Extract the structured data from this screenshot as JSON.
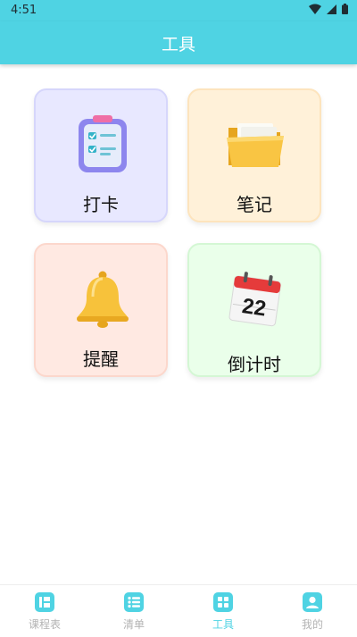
{
  "status_bar": {
    "time": "4:51"
  },
  "header": {
    "title": "工具"
  },
  "tools": [
    {
      "label": "打卡"
    },
    {
      "label": "笔记"
    },
    {
      "label": "提醒"
    },
    {
      "label": "倒计时"
    }
  ],
  "calendar_date": "22",
  "bottom_nav": [
    {
      "label": "课程表",
      "active": false
    },
    {
      "label": "清单",
      "active": false
    },
    {
      "label": "工具",
      "active": true
    },
    {
      "label": "我的",
      "active": false
    }
  ],
  "colors": {
    "accent": "#4fd3e3",
    "inactive": "#b3b3b3"
  }
}
